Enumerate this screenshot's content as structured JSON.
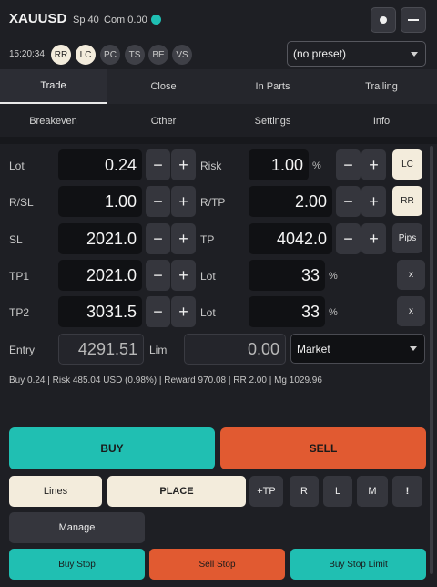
{
  "header": {
    "symbol": "XAUUSD",
    "spread": "Sp 40",
    "commission": "Com 0.00",
    "status_color": "#1fbfb3",
    "time": "15:20:34",
    "pills": [
      {
        "label": "RR",
        "active": true
      },
      {
        "label": "LC",
        "active": true
      },
      {
        "label": "PC",
        "active": false
      },
      {
        "label": "TS",
        "active": false
      },
      {
        "label": "BE",
        "active": false
      },
      {
        "label": "VS",
        "active": false
      }
    ],
    "preset": "(no preset)"
  },
  "tabs_row1": [
    "Trade",
    "Close",
    "In Parts",
    "Trailing"
  ],
  "tabs_row2": [
    "Breakeven",
    "Other",
    "Settings",
    "Info"
  ],
  "active_tab": "Trade",
  "fields": {
    "lot": {
      "label": "Lot",
      "value": "0.24"
    },
    "risk": {
      "label": "Risk",
      "value": "1.00",
      "unit": "%"
    },
    "rsl": {
      "label": "R/SL",
      "value": "1.00"
    },
    "rtp": {
      "label": "R/TP",
      "value": "2.00"
    },
    "sl": {
      "label": "SL",
      "value": "2021.0"
    },
    "tp": {
      "label": "TP",
      "value": "4042.0"
    },
    "tp1": {
      "label": "TP1",
      "value": "2021.0"
    },
    "tp1_lot": {
      "label": "Lot",
      "value": "33",
      "unit": "%"
    },
    "tp2": {
      "label": "TP2",
      "value": "3031.5"
    },
    "tp2_lot": {
      "label": "Lot",
      "value": "33",
      "unit": "%"
    },
    "entry": {
      "label": "Entry",
      "value": "4291.51"
    },
    "lim": {
      "label": "Lim",
      "value": "0.00"
    },
    "order_type": "Market"
  },
  "side_buttons": {
    "lc": "LC",
    "rr": "RR",
    "pips": "Pips",
    "x1": "x",
    "x2": "x"
  },
  "plus": "+",
  "minus": "−",
  "summary": "Buy 0.24 | Risk 485.04 USD (0.98%) | Reward 970.08 | RR 2.00 | Mg 1029.96",
  "actions": {
    "buy": "BUY",
    "sell": "SELL",
    "lines": "Lines",
    "place": "PLACE",
    "plus_tp": "+TP",
    "r": "R",
    "l": "L",
    "m": "M",
    "bang": "!",
    "manage": "Manage",
    "buy_stop": "Buy Stop",
    "sell_stop": "Sell Stop",
    "buy_stop_limit": "Buy Stop Limit"
  },
  "colors": {
    "buy": "#20bfb2",
    "sell": "#e15a31",
    "cream": "#f3ecdc"
  }
}
